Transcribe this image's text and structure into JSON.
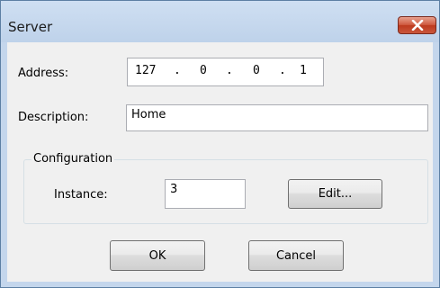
{
  "window": {
    "title": "Server"
  },
  "form": {
    "address_label": "Address:",
    "address_octets": [
      "127",
      "0",
      "0",
      "1"
    ],
    "address_dot": ".",
    "description_label": "Description:",
    "description_value": "Home"
  },
  "configuration": {
    "group_label": "Configuration",
    "instance_label": "Instance:",
    "instance_value": "3",
    "edit_label": "Edit..."
  },
  "buttons": {
    "ok_label": "OK",
    "cancel_label": "Cancel"
  }
}
